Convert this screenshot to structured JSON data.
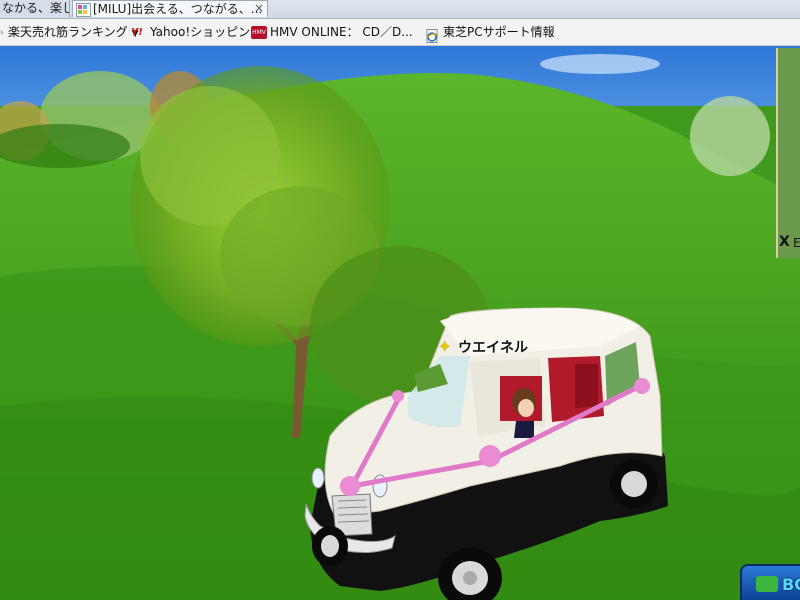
{
  "browser": {
    "tabs": [
      {
        "label": "なかる、楽し..."
      },
      {
        "label": "[MILU]出会える、つながる、..."
      }
    ],
    "tab_close_glyph": "×",
    "bookmarks": [
      {
        "label": "楽天売れ筋ランキング",
        "icon": "rakuten-arrow-icon",
        "has_dropdown": true
      },
      {
        "label": "Yahoo!ショッピング",
        "icon": "yahoo-shopping-icon",
        "icon_text": "Y!"
      },
      {
        "label": "HMV ONLINE： CD／D...",
        "icon": "hmv-icon",
        "icon_text": "HMV"
      },
      {
        "label": "東芝PCサポート情報",
        "icon": "ie-page-icon"
      }
    ],
    "dropdown_glyph": "▼"
  },
  "game": {
    "character_name": "ウエイネル",
    "name_badge_icon": "star-badge-icon",
    "minimap_close_glyph": "X",
    "minimap_partial_text": "E",
    "bottom_button_partial_text": "BO",
    "colors": {
      "sky": "#4a8fe0",
      "grass": "#3f9a1e",
      "car_body": "#f2f0e6",
      "car_lower": "#111111",
      "ribbon": "#e07ac8",
      "interior": "#b01a2a"
    }
  }
}
